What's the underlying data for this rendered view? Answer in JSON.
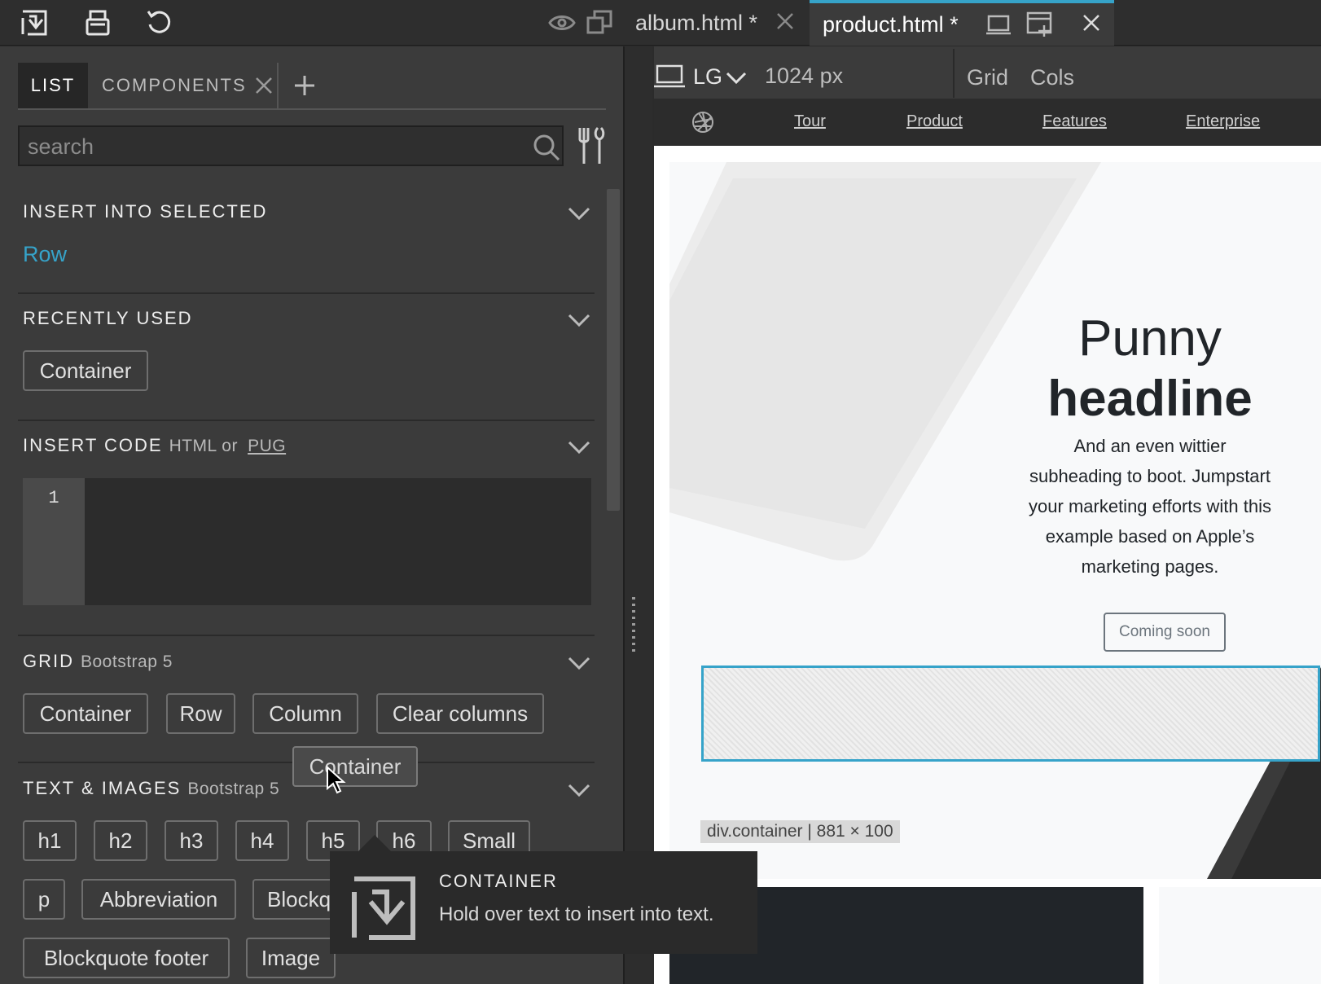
{
  "tabs": [
    {
      "label": "album.html *"
    },
    {
      "label": "product.html *"
    }
  ],
  "panel": {
    "tabs": [
      "LIST",
      "COMPONENTS"
    ],
    "search_placeholder": "search",
    "sections": {
      "insert_into_selected": {
        "title": "INSERT INTO SELECTED",
        "value": "Row"
      },
      "recently_used": {
        "title": "RECENTLY USED",
        "items": [
          "Container"
        ]
      },
      "insert_code": {
        "title": "INSERT CODE",
        "sub_prefix": "HTML or",
        "sub_link": "PUG",
        "line_number": "1"
      },
      "grid": {
        "title": "GRID",
        "sub": "Bootstrap 5",
        "items": [
          "Container",
          "Row",
          "Column",
          "Clear columns"
        ]
      },
      "text_images": {
        "title": "TEXT & IMAGES",
        "sub": "Bootstrap 5",
        "items": [
          "h1",
          "h2",
          "h3",
          "h4",
          "h5",
          "h6",
          "Small",
          "p",
          "Abbreviation",
          "Blockquote",
          "Blockquote footer",
          "Image"
        ]
      }
    }
  },
  "canvas": {
    "device": "LG",
    "width_label": "1024 px",
    "grid_label": "Grid",
    "cols_label": "Cols"
  },
  "site": {
    "nav": [
      "Tour",
      "Product",
      "Features",
      "Enterprise"
    ],
    "hero_title_line1": "Punny",
    "hero_title_line2": "headline",
    "hero_sub": "And an even wittier subheading to boot. Jumpstart your marketing efforts with this example based on Apple’s marketing pages.",
    "hero_button": "Coming soon",
    "selection_label": "div.container | 881 × 100"
  },
  "drag": {
    "label": "Container"
  },
  "tooltip": {
    "title": "CONTAINER",
    "text": "Hold over text to insert into text."
  },
  "colors": {
    "accent": "#36a3c9",
    "panel_bg": "#3b3b3b",
    "topbar_bg": "#2e2e2e"
  }
}
